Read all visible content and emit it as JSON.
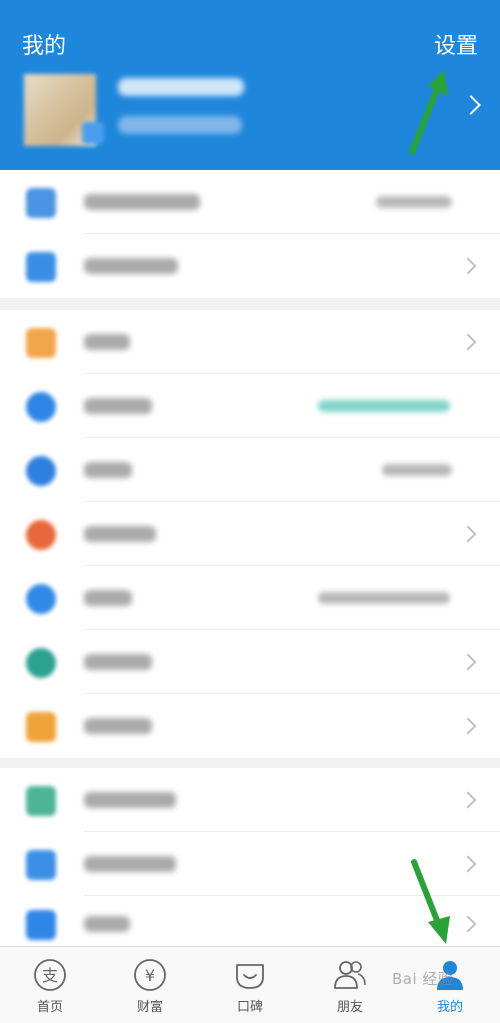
{
  "header": {
    "title": "我的",
    "settings_label": "设置"
  },
  "tabbar": {
    "tabs": [
      {
        "label": "首页",
        "icon": "home-alipay-icon"
      },
      {
        "label": "财富",
        "icon": "wealth-yen-icon"
      },
      {
        "label": "口碑",
        "icon": "koubei-icon"
      },
      {
        "label": "朋友",
        "icon": "friends-icon"
      },
      {
        "label": "我的",
        "icon": "me-person-icon"
      }
    ],
    "active": "我的"
  },
  "watermark": "Bai 经验",
  "colors": {
    "brand_blue": "#1e87db",
    "annotation_arrow": "#2aa336"
  }
}
